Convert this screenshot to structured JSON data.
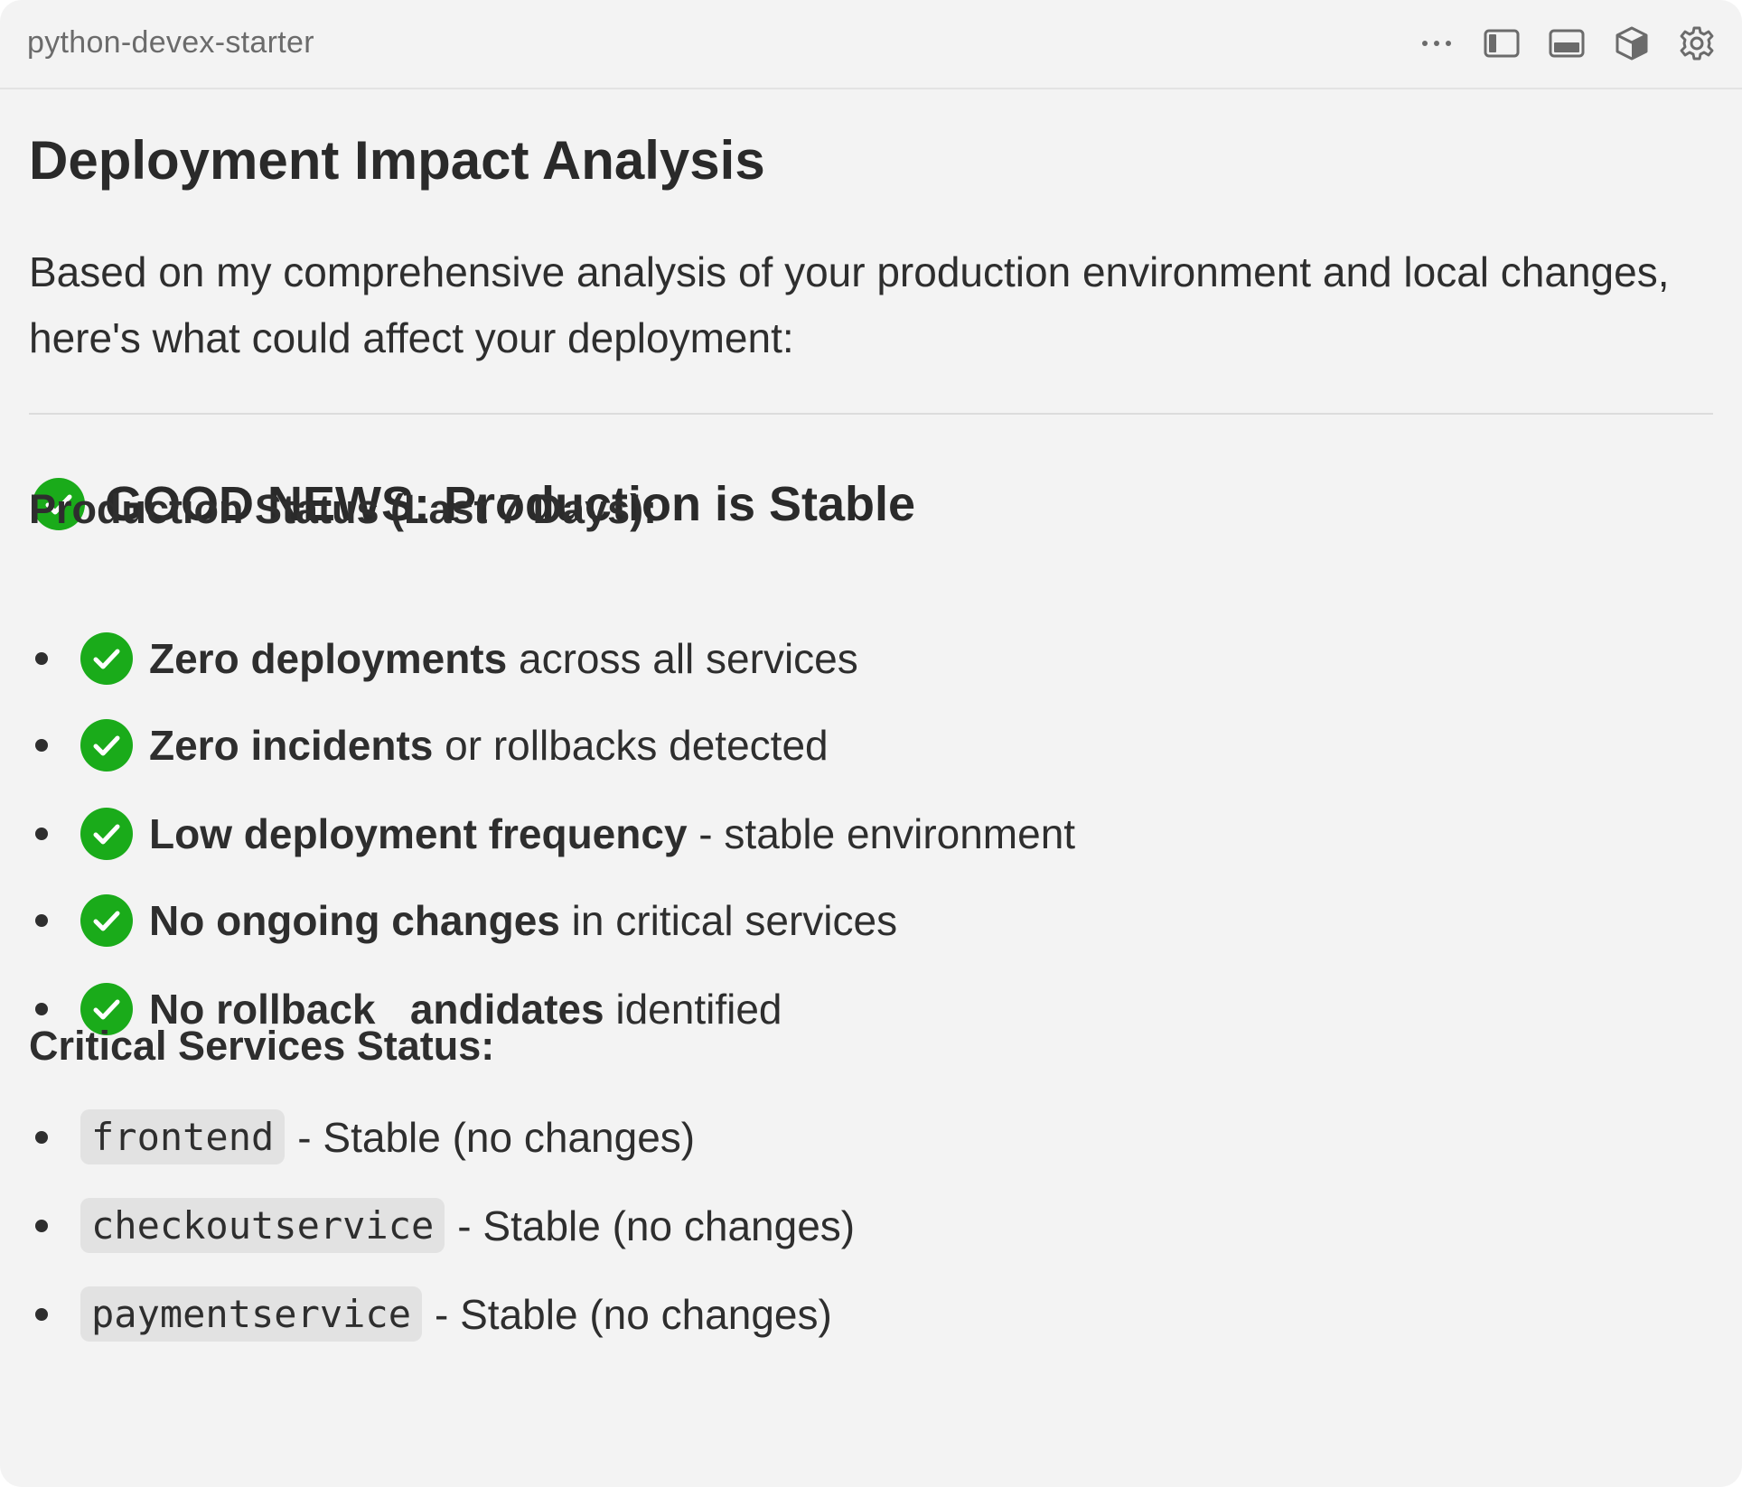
{
  "window": {
    "title": "python-devex-starter"
  },
  "toolbar": {
    "icons": [
      "more-icon",
      "sidebar-left-icon",
      "panel-bottom-icon",
      "cube-icon",
      "gear-icon"
    ]
  },
  "content": {
    "heading": "Deployment Impact Analysis",
    "intro": "Based on my comprehensive analysis of your production environment and local changes, here's what could affect your deployment:",
    "good_news": {
      "icon": "check-circle-icon",
      "title": "GOOD NEWS: Production is Stable"
    },
    "production_status": {
      "title": "Production Status (Last 7 Days):",
      "items": [
        {
          "bold": "Zero deployments",
          "rest": " across all services"
        },
        {
          "bold": "Zero incidents",
          "rest": " or rollbacks detected"
        },
        {
          "bold": "Low deployment frequency",
          "rest": " - stable environment"
        },
        {
          "bold": "No ongoing changes",
          "rest": " in critical services"
        },
        {
          "bold": "No rollback   andidates",
          "rest": " identified"
        }
      ]
    },
    "critical_services": {
      "title": "Critical Services Status:",
      "items": [
        {
          "service": "frontend",
          "status": "- Stable (no changes)"
        },
        {
          "service": "checkoutservice",
          "status": "- Stable (no changes)"
        },
        {
          "service": "paymentservice",
          "status": "- Stable (no changes)"
        }
      ]
    }
  },
  "colors": {
    "check_green": "#1aab1a",
    "background": "#f3f3f3",
    "code_bg": "#e2e2e2"
  }
}
